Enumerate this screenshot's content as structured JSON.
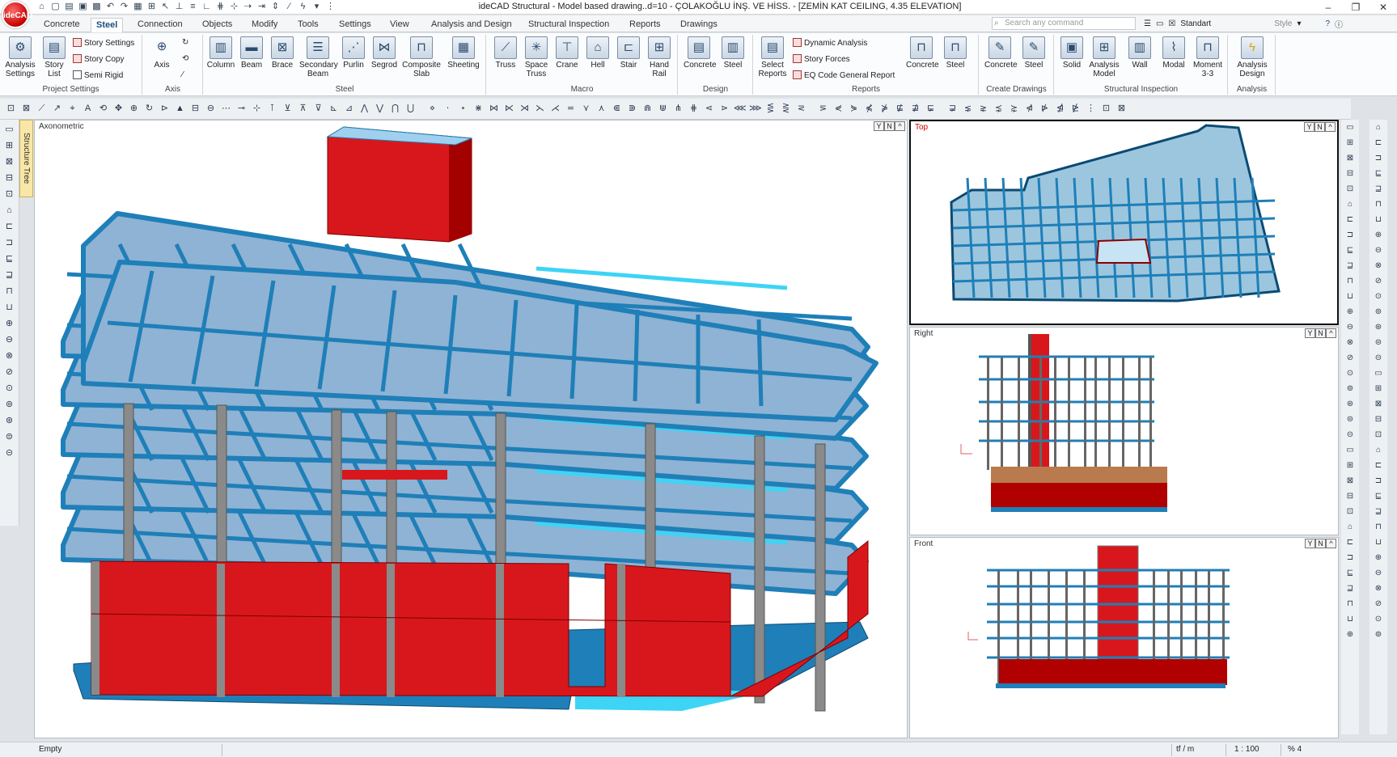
{
  "window": {
    "title": "ideCAD Structural - Model based drawing..d=10 - ÇOLAKOĞLU İNŞ. VE HİSS. - [ZEMİN KAT CEILING, 4.35 ELEVATION]",
    "logo": "ideCAD",
    "min_label": "–",
    "max_label": "❐",
    "close_label": "✕"
  },
  "tabs": [
    {
      "label": "Concrete"
    },
    {
      "label": "Steel",
      "active": true
    },
    {
      "label": "Connection"
    },
    {
      "label": "Objects"
    },
    {
      "label": "Modify"
    },
    {
      "label": "Tools"
    },
    {
      "label": "Settings"
    },
    {
      "label": "View"
    },
    {
      "label": "Analysis and Design"
    },
    {
      "label": "Structural Inspection"
    },
    {
      "label": "Reports"
    },
    {
      "label": "Drawings"
    }
  ],
  "search": {
    "placeholder": "Search any command"
  },
  "style_selector": {
    "value": "Standart",
    "label": "Style"
  },
  "ribbon": {
    "project_settings": {
      "label": "Project Settings",
      "analysis_settings": "Analysis Settings",
      "story_list": "Story List",
      "story_settings": "Story Settings",
      "story_copy": "Story Copy",
      "semi_rigid": "Semi Rigid"
    },
    "axis": {
      "label": "Axis",
      "axis_btn": "Axis"
    },
    "steel": {
      "label": "Steel",
      "column": "Column",
      "beam": "Beam",
      "brace": "Brace",
      "secondary_beam": "Secondary Beam",
      "purlin": "Purlin",
      "segrod": "Segrod",
      "composite_slab": "Composite Slab",
      "sheeting": "Sheeting"
    },
    "macro": {
      "label": "Macro",
      "truss": "Truss",
      "space_truss": "Space Truss",
      "crane": "Crane",
      "hell": "Hell",
      "stair": "Stair",
      "hand_rail": "Hand Rail"
    },
    "design": {
      "label": "Design",
      "concrete": "Concrete",
      "steel": "Steel"
    },
    "reports": {
      "label": "Reports",
      "select_reports": "Select Reports",
      "dynamic_analysis": "Dynamic Analysis",
      "story_forces": "Story Forces",
      "eq_code": "EQ Code General Report",
      "concrete": "Concrete",
      "steel": "Steel"
    },
    "create_drawings": {
      "label": "Create Drawings",
      "concrete": "Concrete",
      "steel": "Steel"
    },
    "structural_inspection": {
      "label": "Structural Inspection",
      "solid": "Solid",
      "analysis_model": "Analysis Model",
      "wall": "Wall",
      "modal": "Modal",
      "moment": "Moment 3-3"
    },
    "analysis": {
      "label": "Analysis",
      "analysis_design": "Analysis Design"
    }
  },
  "left_panel": {
    "structure_tree": "Structure Tree"
  },
  "viewports": {
    "axonometric": {
      "label": "Axonometric"
    },
    "top": {
      "label": "Top"
    },
    "right": {
      "label": "Right"
    },
    "front": {
      "label": "Front"
    }
  },
  "vp_buttons": {
    "b1": "Y",
    "b2": "N",
    "b3": "^"
  },
  "status": {
    "message": "Empty",
    "units": "tf / m",
    "scale": "1 : 100",
    "zoom": "% 4"
  },
  "colors": {
    "steel_beam": "#1f7fb8",
    "slab": "#8fb3d4",
    "wall_red": "#d8171c",
    "column_gray": "#8a8a8a",
    "highlight": "#3dd4f5"
  }
}
